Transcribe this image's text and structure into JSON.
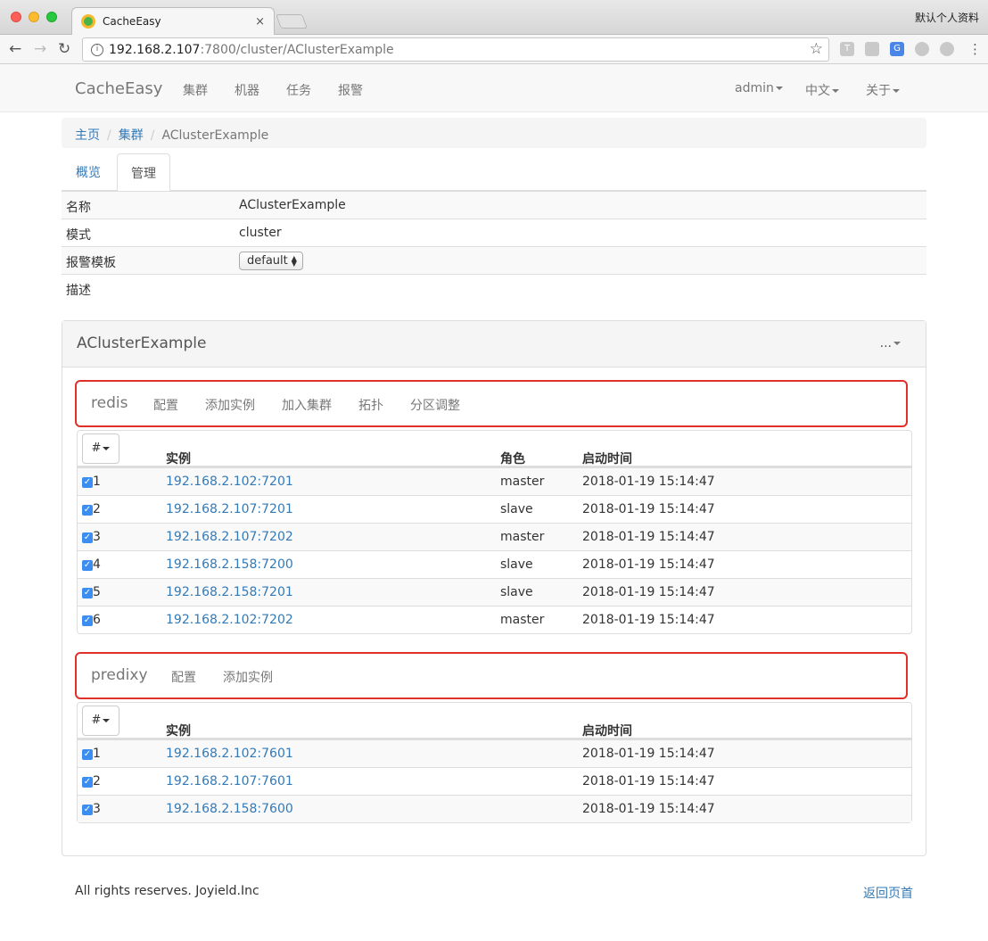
{
  "browser": {
    "tab_title": "CacheEasy",
    "tab_close": "×",
    "profile": "默认个人资料",
    "url_host": "192.168.2.107",
    "url_rest": ":7800/cluster/AClusterExample",
    "back": "←",
    "forward": "→",
    "reload": "↻",
    "star": "☆",
    "info": "i"
  },
  "navbar": {
    "brand": "CacheEasy",
    "links": [
      "集群",
      "机器",
      "任务",
      "报警"
    ],
    "admin": "admin",
    "lang": "中文",
    "about": "关于"
  },
  "breadcrumb": {
    "home": "主页",
    "cluster": "集群",
    "current": "AClusterExample",
    "sep": "/"
  },
  "tabs": {
    "overview": "概览",
    "manage": "管理"
  },
  "info": {
    "name_label": "名称",
    "name_value": "AClusterExample",
    "mode_label": "模式",
    "mode_value": "cluster",
    "alarm_label": "报警模板",
    "alarm_value": "default",
    "desc_label": "描述"
  },
  "panel": {
    "title": "AClusterExample",
    "menu": "..."
  },
  "redis": {
    "name": "redis",
    "actions": [
      "配置",
      "添加实例",
      "加入集群",
      "拓扑",
      "分区调整"
    ],
    "hash_btn": "#",
    "col_instance": "实例",
    "col_role": "角色",
    "col_time": "启动时间",
    "rows": [
      {
        "idx": "1",
        "instance": "192.168.2.102:7201",
        "role": "master",
        "time": "2018-01-19 15:14:47"
      },
      {
        "idx": "2",
        "instance": "192.168.2.107:7201",
        "role": "slave",
        "time": "2018-01-19 15:14:47"
      },
      {
        "idx": "3",
        "instance": "192.168.2.107:7202",
        "role": "master",
        "time": "2018-01-19 15:14:47"
      },
      {
        "idx": "4",
        "instance": "192.168.2.158:7200",
        "role": "slave",
        "time": "2018-01-19 15:14:47"
      },
      {
        "idx": "5",
        "instance": "192.168.2.158:7201",
        "role": "slave",
        "time": "2018-01-19 15:14:47"
      },
      {
        "idx": "6",
        "instance": "192.168.2.102:7202",
        "role": "master",
        "time": "2018-01-19 15:14:47"
      }
    ]
  },
  "predixy": {
    "name": "predixy",
    "actions": [
      "配置",
      "添加实例"
    ],
    "hash_btn": "#",
    "col_instance": "实例",
    "col_time": "启动时间",
    "rows": [
      {
        "idx": "1",
        "instance": "192.168.2.102:7601",
        "time": "2018-01-19 15:14:47"
      },
      {
        "idx": "2",
        "instance": "192.168.2.107:7601",
        "time": "2018-01-19 15:14:47"
      },
      {
        "idx": "3",
        "instance": "192.168.2.158:7600",
        "time": "2018-01-19 15:14:47"
      }
    ]
  },
  "footer": {
    "copyright": "All rights reserves. Joyield.Inc",
    "back_top": "返回页首"
  },
  "colors": {
    "link": "#337ab7",
    "highlight_border": "#e0302a",
    "checkbox": "#3b8df1"
  }
}
